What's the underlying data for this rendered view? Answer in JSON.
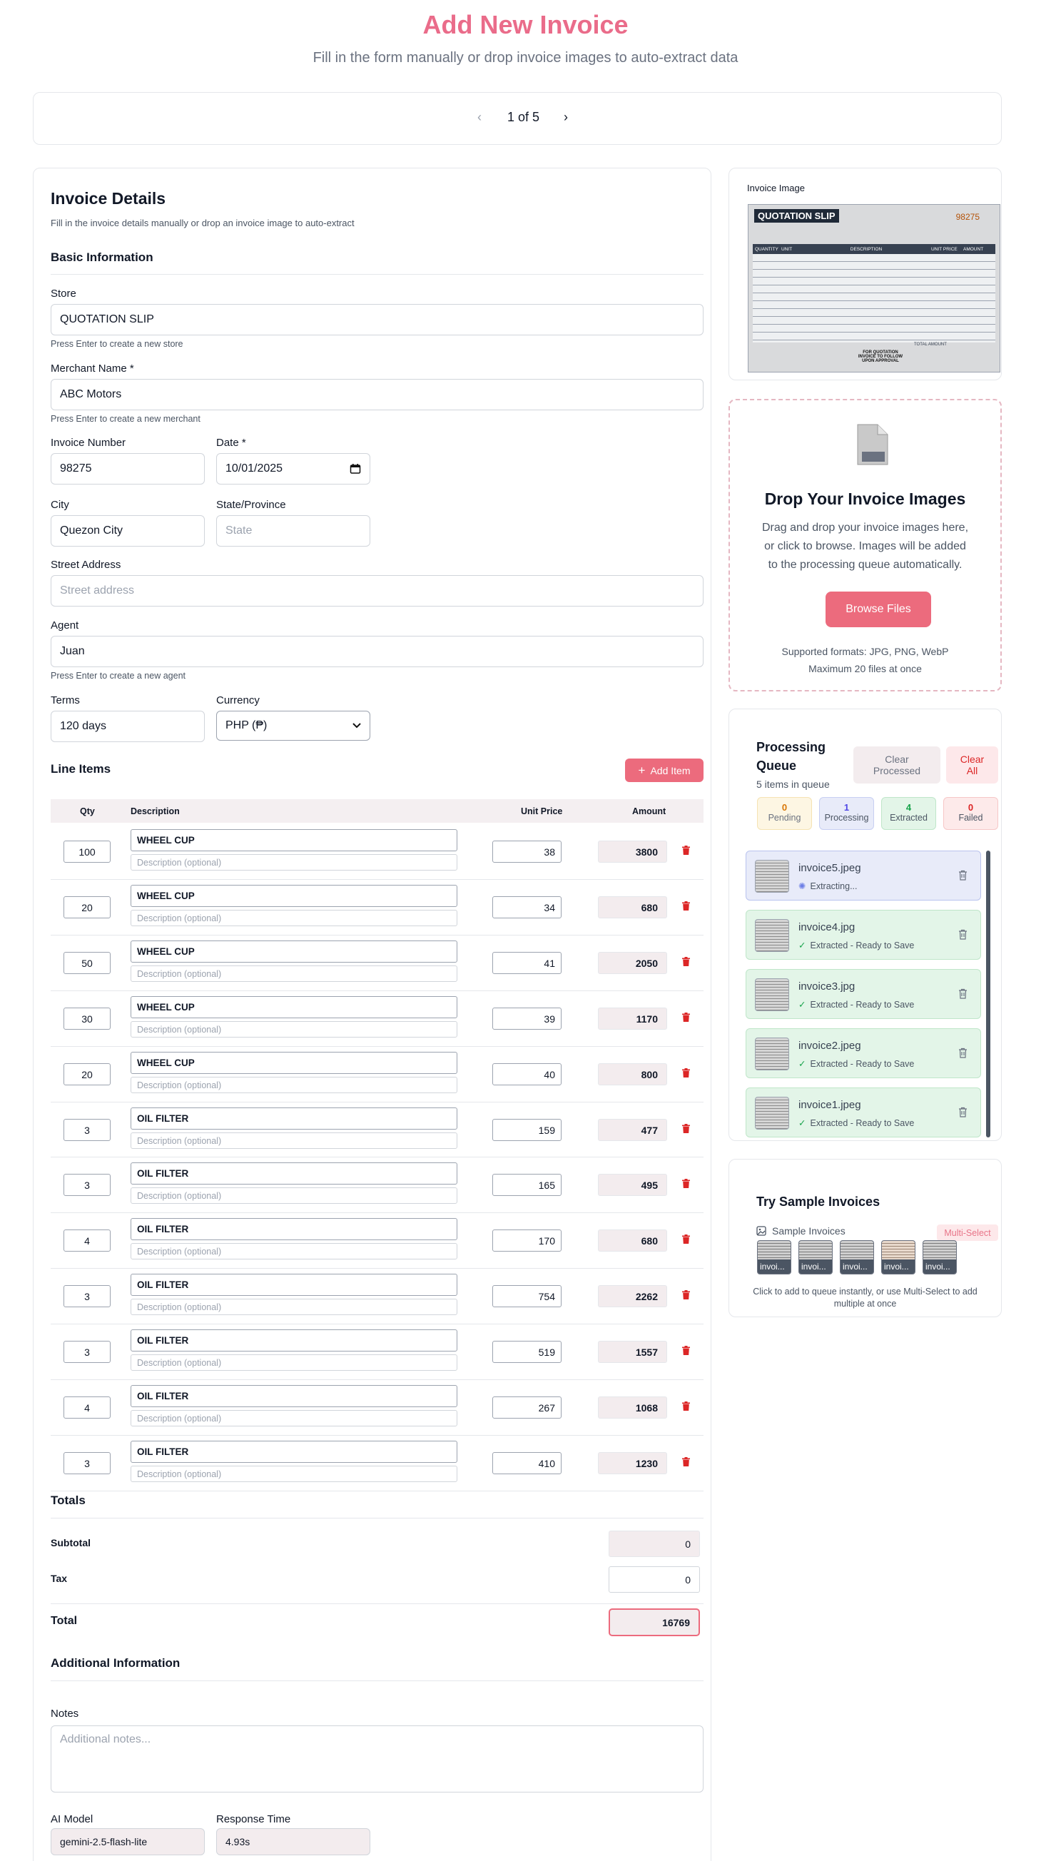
{
  "header": {
    "title": "Add New Invoice",
    "subtitle": "Fill in the form manually or drop invoice images to auto-extract data"
  },
  "pager": {
    "label": "1 of 5"
  },
  "form": {
    "title": "Invoice Details",
    "subtitle": "Fill in the invoice details manually or drop an invoice image to auto-extract",
    "basic_heading": "Basic Information",
    "store_label": "Store",
    "store_value": "QUOTATION SLIP",
    "store_help": "Press Enter to create a new store",
    "merchant_label": "Merchant Name *",
    "merchant_value": "ABC Motors",
    "merchant_help": "Press Enter to create a new merchant",
    "invoice_number_label": "Invoice Number",
    "invoice_number_value": "98275",
    "date_label": "Date *",
    "date_value": "10/01/2025",
    "city_label": "City",
    "city_value": "Quezon City",
    "state_label": "State/Province",
    "state_placeholder": "State",
    "street_label": "Street Address",
    "street_placeholder": "Street address",
    "agent_label": "Agent",
    "agent_value": "Juan",
    "agent_help": "Press Enter to create a new agent",
    "terms_label": "Terms",
    "terms_value": "120 days",
    "currency_label": "Currency",
    "currency_value": "PHP (₱)"
  },
  "line_items": {
    "heading": "Line Items",
    "add_label": "Add Item",
    "columns": [
      "Qty",
      "Description",
      "Unit Price",
      "Amount"
    ],
    "desc_placeholder": "Description (optional)",
    "rows": [
      {
        "qty": "100",
        "name": "WHEEL CUP",
        "price": "38",
        "amount": "3800"
      },
      {
        "qty": "20",
        "name": "WHEEL CUP",
        "price": "34",
        "amount": "680"
      },
      {
        "qty": "50",
        "name": "WHEEL CUP",
        "price": "41",
        "amount": "2050"
      },
      {
        "qty": "30",
        "name": "WHEEL CUP",
        "price": "39",
        "amount": "1170"
      },
      {
        "qty": "20",
        "name": "WHEEL CUP",
        "price": "40",
        "amount": "800"
      },
      {
        "qty": "3",
        "name": "OIL FILTER",
        "price": "159",
        "amount": "477"
      },
      {
        "qty": "3",
        "name": "OIL FILTER",
        "price": "165",
        "amount": "495"
      },
      {
        "qty": "4",
        "name": "OIL FILTER",
        "price": "170",
        "amount": "680"
      },
      {
        "qty": "3",
        "name": "OIL FILTER",
        "price": "754",
        "amount": "2262"
      },
      {
        "qty": "3",
        "name": "OIL FILTER",
        "price": "519",
        "amount": "1557"
      },
      {
        "qty": "4",
        "name": "OIL FILTER",
        "price": "267",
        "amount": "1068"
      },
      {
        "qty": "3",
        "name": "OIL FILTER",
        "price": "410",
        "amount": "1230"
      }
    ]
  },
  "totals": {
    "heading": "Totals",
    "subtotal_label": "Subtotal",
    "subtotal_value": "0",
    "tax_label": "Tax",
    "tax_value": "0",
    "total_label": "Total",
    "total_value": "16769"
  },
  "additional": {
    "heading": "Additional Information",
    "notes_label": "Notes",
    "notes_placeholder": "Additional notes...",
    "ai_label": "AI Model",
    "ai_value": "gemini-2.5-flash-lite",
    "rt_label": "Response Time",
    "rt_value": "4.93s"
  },
  "invoice_image": {
    "label": "Invoice Image",
    "doc_title": "QUOTATION SLIP",
    "doc_number": "98275",
    "doc_columns": [
      "QUANTITY",
      "UNIT",
      "DESCRIPTION",
      "UNIT PRICE",
      "AMOUNT"
    ],
    "doc_total_label": "TOTAL AMOUNT",
    "doc_footer": "FOR QUOTATION INVOICE TO FOLLOW UPON APPROVAL"
  },
  "drop": {
    "title": "Drop Your Invoice Images",
    "text": "Drag and drop your invoice images here, or click to browse. Images will be added to the processing queue automatically.",
    "button": "Browse Files",
    "formats": "Supported formats: JPG, PNG, WebP",
    "max": "Maximum 20 files at once"
  },
  "queue": {
    "title": "Processing Queue",
    "count": "5 items in queue",
    "clear_processed": "Clear Processed",
    "clear_all": "Clear All",
    "stats": [
      {
        "n": "0",
        "label": "Pending"
      },
      {
        "n": "1",
        "label": "Processing"
      },
      {
        "n": "4",
        "label": "Extracted"
      },
      {
        "n": "0",
        "label": "Failed"
      }
    ],
    "items": [
      {
        "name": "invoice5.jpeg",
        "status": "Extracting..."
      },
      {
        "name": "invoice4.jpg",
        "status": "Extracted - Ready to Save"
      },
      {
        "name": "invoice3.jpg",
        "status": "Extracted - Ready to Save"
      },
      {
        "name": "invoice2.jpeg",
        "status": "Extracted - Ready to Save"
      },
      {
        "name": "invoice1.jpeg",
        "status": "Extracted - Ready to Save"
      }
    ],
    "colors": {
      "processing_bg": "#e8ebf9",
      "extracted_bg": "#e3f5e8",
      "pending_bg": "#fdf6e3",
      "failed_bg": "#fdeaea"
    }
  },
  "samples": {
    "title": "Try Sample Invoices",
    "label": "Sample Invoices",
    "multi": "Multi-Select",
    "thumbs": [
      "invoi...",
      "invoi...",
      "invoi...",
      "invoi...",
      "invoi..."
    ],
    "help": "Click to add to queue instantly, or use Multi-Select to add multiple at once"
  },
  "theme": {
    "accent": "#ec6b7d",
    "accent_text": "#ea6c8a"
  }
}
